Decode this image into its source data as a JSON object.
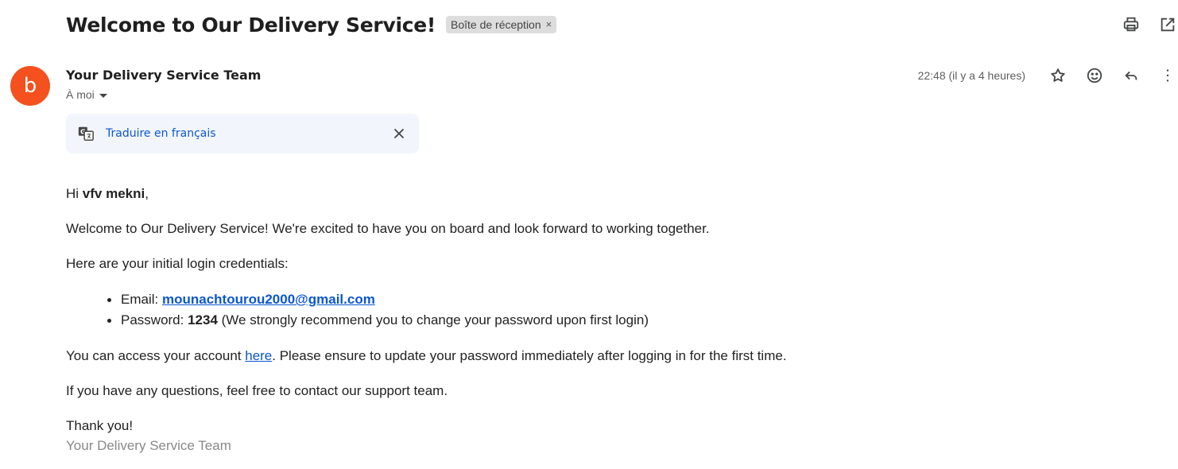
{
  "header": {
    "subject": "Welcome to Our Delivery Service!",
    "label": "Boîte de réception",
    "label_close": "×"
  },
  "sender": {
    "avatar_letter": "b",
    "avatar_color": "#f4511e",
    "name": "Your Delivery Service Team",
    "to": "À moi",
    "time": "22:48 (il y a 4 heures)"
  },
  "translate": {
    "link": "Traduire en français"
  },
  "body": {
    "greeting_prefix": "Hi ",
    "greeting_name": "vfv mekni",
    "greeting_suffix": ",",
    "welcome": "Welcome to Our Delivery Service! We're excited to have you on board and look forward to working together.",
    "creds_intro": "Here are your initial login credentials:",
    "email_label": "Email: ",
    "email_value": "mounachtourou2000@gmail.com",
    "password_label": "Password: ",
    "password_value": "1234",
    "password_note": " (We strongly recommend you to change your password upon first login)",
    "access_prefix": "You can access your account ",
    "access_link": "here",
    "access_suffix": ". Please ensure to update your password immediately after logging in for the first time.",
    "questions": "If you have any questions, feel free to contact our support team.",
    "thanks": "Thank you!",
    "signature": "Your Delivery Service Team"
  },
  "icons": {
    "print": "print-icon",
    "open_new": "open-in-new-icon",
    "star": "star-icon",
    "emoji": "emoji-icon",
    "reply": "reply-icon",
    "more": "more-vert-icon",
    "translate": "translate-icon",
    "close": "close-icon"
  },
  "colors": {
    "link": "#0b57d0",
    "translate_bg": "#f2f6fc",
    "chip_bg": "#dddddd"
  }
}
